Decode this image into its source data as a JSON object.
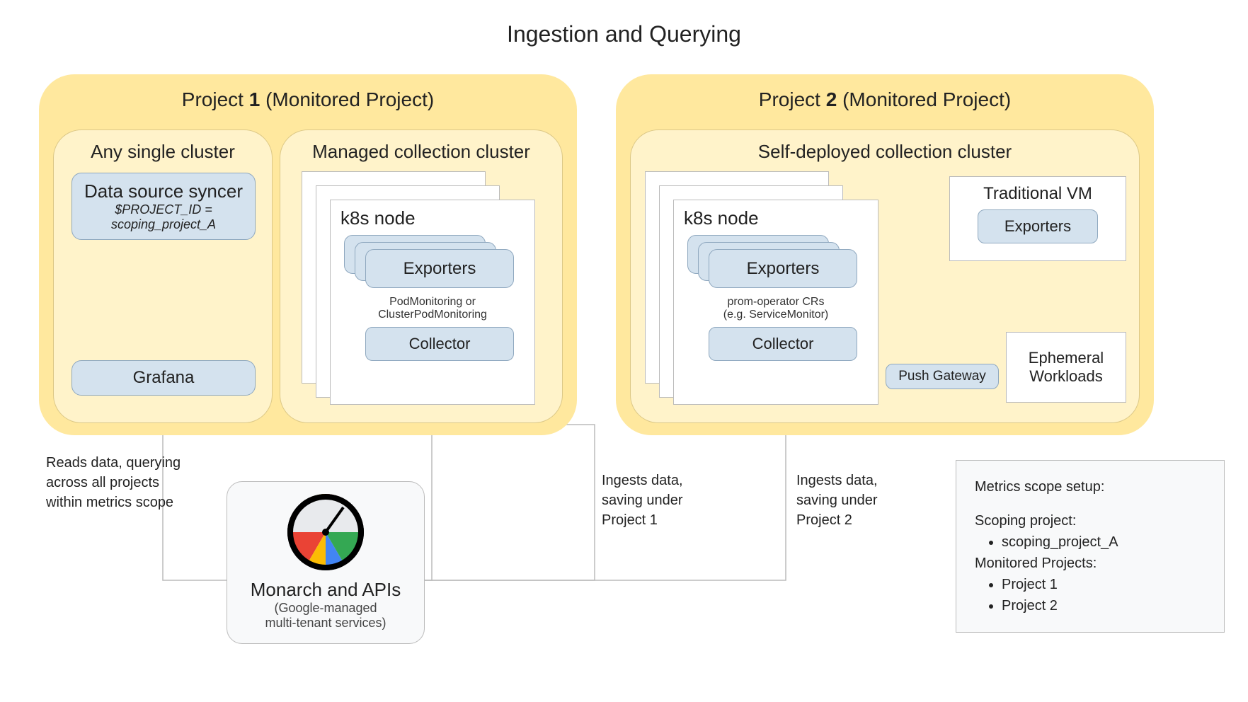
{
  "title": "Ingestion and Querying",
  "project1": {
    "title_prefix": "Project ",
    "title_bold": "1",
    "title_suffix": " (Monitored Project)",
    "single_cluster": {
      "title": "Any single cluster",
      "syncer_title": "Data source syncer",
      "syncer_line1": "$PROJECT_ID =",
      "syncer_line2": "scoping_project_A",
      "grafana": "Grafana"
    },
    "managed_cluster": {
      "title": "Managed collection cluster",
      "k8s": "k8s node",
      "exporters": "Exporters",
      "crd_line1": "PodMonitoring or",
      "crd_line2": "ClusterPodMonitoring",
      "collector": "Collector"
    }
  },
  "project2": {
    "title_prefix": "Project ",
    "title_bold": "2",
    "title_suffix": " (Monitored Project)",
    "self_cluster": {
      "title": "Self-deployed collection cluster",
      "k8s": "k8s node",
      "exporters": "Exporters",
      "crd_line1": "prom-operator CRs",
      "crd_line2": "(e.g. ServiceMonitor)",
      "collector": "Collector",
      "push_gw": "Push Gateway",
      "trad_vm": "Traditional VM",
      "trad_vm_exporters": "Exporters",
      "ephemeral": "Ephemeral Workloads"
    }
  },
  "annotations": {
    "reads": "Reads data, querying across all projects within metrics scope",
    "ingest1a": "Ingests data,",
    "ingest1b": "saving under",
    "ingest1c": "Project 1",
    "ingest2a": "Ingests data,",
    "ingest2b": "saving under",
    "ingest2c": "Project 2"
  },
  "monarch": {
    "title": "Monarch and APIs",
    "sub1": "(Google-managed",
    "sub2": "multi-tenant services)"
  },
  "info": {
    "title": "Metrics scope setup:",
    "scoping_lbl": "Scoping project:",
    "scoping_val": "scoping_project_A",
    "monitored_lbl": "Monitored Projects:",
    "p1": "Project 1",
    "p2": "Project 2"
  }
}
